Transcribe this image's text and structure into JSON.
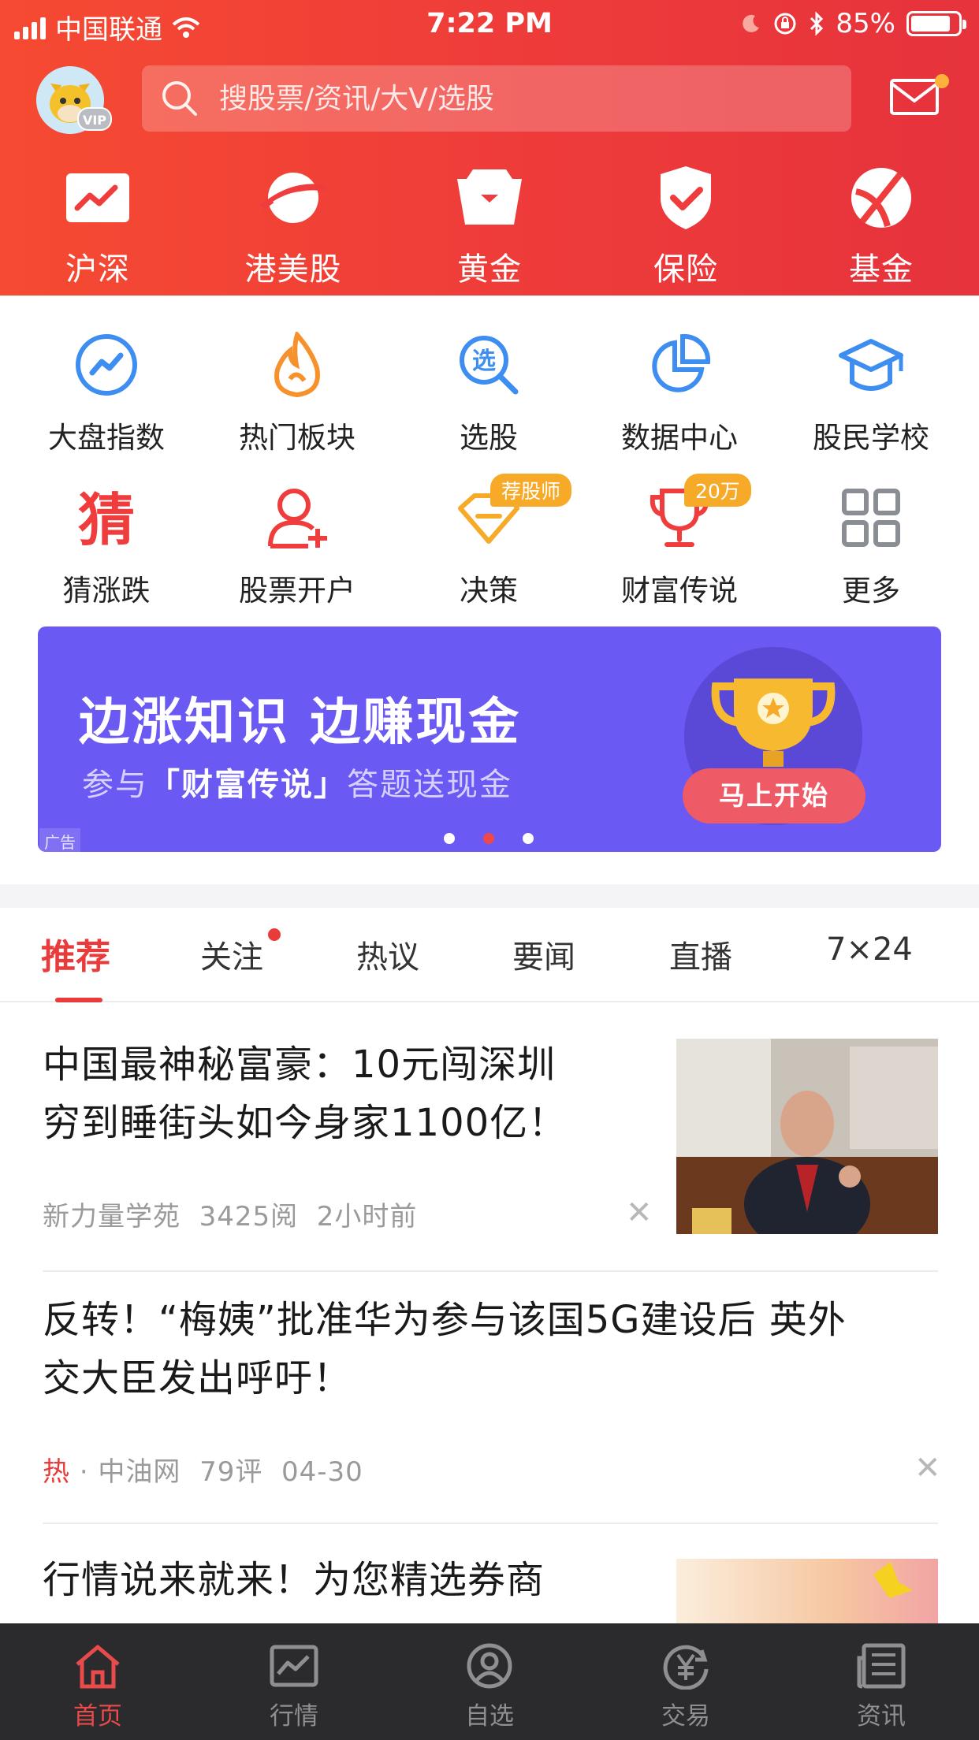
{
  "status_bar": {
    "carrier": "中国联通",
    "time": "7:22 PM",
    "battery": "85%",
    "battery_level": 0.85
  },
  "search": {
    "placeholder": "搜股票/资讯/大V/选股"
  },
  "avatar": {
    "badge": "VIP"
  },
  "top_nav": [
    {
      "label": "沪深",
      "icon": "trend-chart-icon"
    },
    {
      "label": "港美股",
      "icon": "planet-icon"
    },
    {
      "label": "黄金",
      "icon": "gold-box-icon"
    },
    {
      "label": "保险",
      "icon": "shield-check-icon"
    },
    {
      "label": "基金",
      "icon": "fund-ball-icon"
    }
  ],
  "grid": [
    {
      "label": "大盘指数",
      "icon": "index-chart-icon"
    },
    {
      "label": "热门板块",
      "icon": "fire-icon"
    },
    {
      "label": "选股",
      "icon": "select-search-icon",
      "glyph": "选"
    },
    {
      "label": "数据中心",
      "icon": "pie-chart-icon"
    },
    {
      "label": "股民学校",
      "icon": "graduation-cap-icon"
    },
    {
      "label": "猜涨跌",
      "icon": "guess-icon",
      "glyph": "猜"
    },
    {
      "label": "股票开户",
      "icon": "add-user-icon"
    },
    {
      "label": "决策",
      "icon": "decision-icon",
      "badge": "荐股师"
    },
    {
      "label": "财富传说",
      "icon": "trophy-icon",
      "badge": "20万"
    },
    {
      "label": "更多",
      "icon": "more-grid-icon"
    }
  ],
  "banner": {
    "title": "边涨知识 边赚现金",
    "sub_prefix": "参与",
    "sub_highlight": "「财富传说」",
    "sub_suffix": "答题送现金",
    "button": "马上开始",
    "ad_label": "广告",
    "active_dot": 1,
    "colors": {
      "background": "#6a59f2",
      "button": "#ef5a67"
    }
  },
  "tabs": [
    {
      "label": "推荐",
      "active": true
    },
    {
      "label": "关注",
      "active": false,
      "has_dot": true
    },
    {
      "label": "热议",
      "active": false
    },
    {
      "label": "要闻",
      "active": false
    },
    {
      "label": "直播",
      "active": false
    },
    {
      "label": "7×24",
      "active": false
    }
  ],
  "news": [
    {
      "title_line1": "中国最神秘富豪：10元闯深圳",
      "title_line2": "穷到睡街头如今身家1100亿！",
      "source": "新力量学苑",
      "reads": "3425阅",
      "time": "2小时前",
      "has_image": true
    },
    {
      "title_line1": "反转！“梅姨”批准华为参与该国5G建设后 英外",
      "title_line2": "交大臣发出呼吁！",
      "hot": "热",
      "source": "· 中油网",
      "comments": "79评",
      "time": "04-30",
      "has_image": false
    },
    {
      "title_line1": "行情说来就来！为您精选券商",
      "has_image": true
    }
  ],
  "bottom_nav": [
    {
      "label": "首页",
      "icon": "home-icon",
      "active": true
    },
    {
      "label": "行情",
      "icon": "market-chart-icon",
      "active": false
    },
    {
      "label": "自选",
      "icon": "watchlist-user-icon",
      "active": false
    },
    {
      "label": "交易",
      "icon": "trade-yen-icon",
      "active": false
    },
    {
      "label": "资讯",
      "icon": "news-icon",
      "active": false
    }
  ],
  "colors": {
    "brand_red": "#ee3b3a",
    "active_tab": "#e93b3b",
    "bottom_bar": "#2b2b2d"
  }
}
